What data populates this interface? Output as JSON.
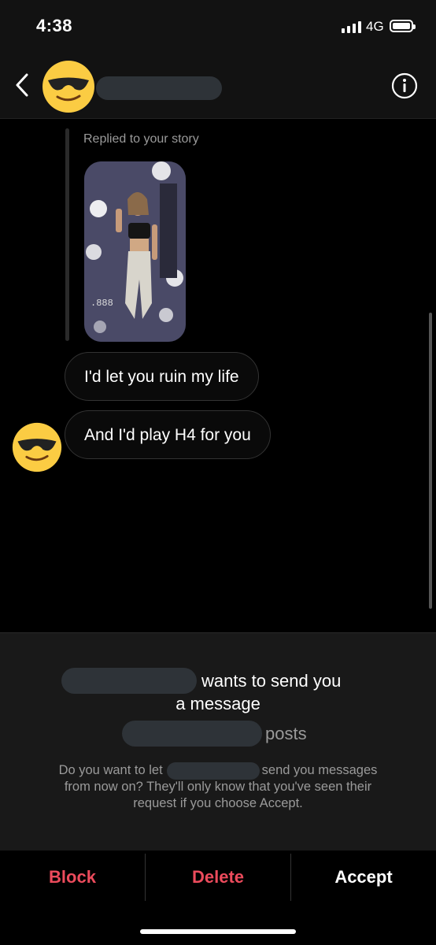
{
  "status_bar": {
    "time": "4:38",
    "network": "4G"
  },
  "header": {
    "back_icon": "chevron-left-icon",
    "info_icon": "info-icon",
    "avatar": "sunglasses-emoji-avatar"
  },
  "thread": {
    "reply_label": "Replied to your story",
    "story_caption_icon": "story-thumbnail",
    "messages": [
      {
        "text": "I'd let you ruin my life"
      },
      {
        "text": "And I'd play H4 for you"
      }
    ]
  },
  "request": {
    "wants_text": "wants to send you",
    "message_text": "a message",
    "posts_text": "posts",
    "question_part1": "Do you want to let",
    "question_part2": "send you messages",
    "question_line2": "from now on? They'll only know that you've seen their",
    "question_line3": "request if you choose Accept."
  },
  "actions": {
    "block": "Block",
    "delete": "Delete",
    "accept": "Accept"
  },
  "colors": {
    "destructive": "#ec4b5c",
    "background": "#000000",
    "panel": "#191919",
    "redaction": "#2e3338"
  }
}
